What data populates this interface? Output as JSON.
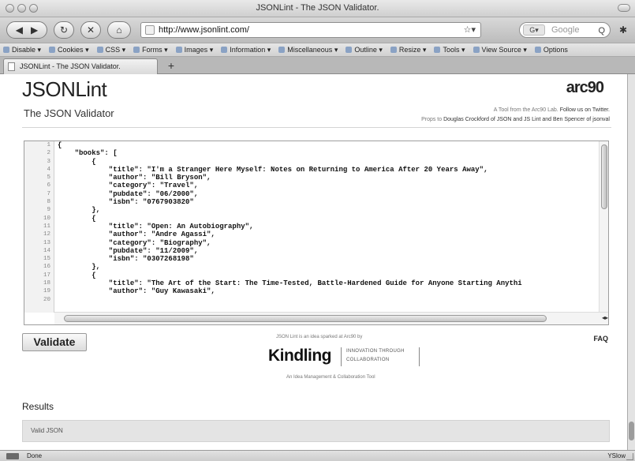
{
  "window": {
    "title": "JSONLint - The JSON Validator."
  },
  "toolbar": {
    "url": "http://www.jsonlint.com/",
    "search_placeholder": "Google",
    "star_glyph": "☆▾",
    "search_engine_glyph": "G▾",
    "search_glyph": "Q"
  },
  "extbar": {
    "items": [
      "Disable",
      "Cookies",
      "CSS",
      "Forms",
      "Images",
      "Information",
      "Miscellaneous",
      "Outline",
      "Resize",
      "Tools",
      "View Source",
      "Options"
    ]
  },
  "tabs": [
    {
      "label": "JSONLint - The JSON Validator."
    }
  ],
  "page": {
    "brand": "JSONLint",
    "tagline": "The JSON Validator",
    "logo": "arc90",
    "credits_line1": "A Tool from the Arc90 Lab.",
    "credits_follow": "Follow us on Twitter.",
    "credits_line2_prefix": "Props to",
    "credits_line2_names": "Douglas Crockford of JSON and JS Lint and Ben Spencer of jsonval"
  },
  "editor": {
    "line_numbers": [
      "1",
      "2",
      "3",
      "4",
      "5",
      "6",
      "7",
      "8",
      "9",
      "10",
      "11",
      "12",
      "13",
      "14",
      "15",
      "16",
      "17",
      "18",
      "19",
      "20"
    ],
    "lines": [
      "{",
      "    \"books\": [",
      "        {",
      "            \"title\": \"I'm a Stranger Here Myself: Notes on Returning to America After 20 Years Away\",",
      "            \"author\": \"Bill Bryson\",",
      "            \"category\": \"Travel\",",
      "            \"pubdate\": \"06/2000\",",
      "            \"isbn\": \"0767903820\"",
      "        },",
      "        {",
      "            \"title\": \"Open: An Autobiography\",",
      "            \"author\": \"Andre Agassi\",",
      "            \"category\": \"Biography\",",
      "            \"pubdate\": \"11/2009\",",
      "            \"isbn\": \"0307268198\"",
      "        },",
      "        {",
      "            \"title\": \"The Art of the Start: The Time-Tested, Battle-Hardened Guide for Anyone Starting Anythi",
      "            \"author\": \"Guy Kawasaki\",",
      ""
    ]
  },
  "actions": {
    "validate_label": "Validate",
    "faq_label": "FAQ"
  },
  "sponsor": {
    "top_text": "JSON Lint is an idea sparked at Arc90 by",
    "name": "Kindling",
    "tagline_line1": "INNOVATION THROUGH",
    "tagline_line2": "COLLABORATION",
    "bottom_text": "An Idea Management & Collaboration Tool"
  },
  "results": {
    "heading": "Results",
    "message": "Valid JSON"
  },
  "statusbar": {
    "text": "Done",
    "right_text": "YSlow"
  }
}
